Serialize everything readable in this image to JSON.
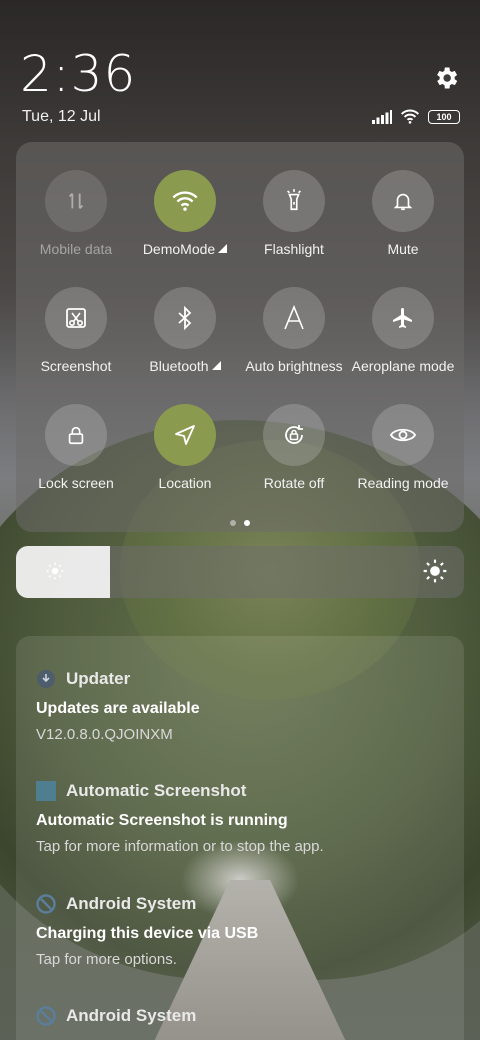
{
  "status": {
    "time": "2:36",
    "date": "Tue, 12 Jul",
    "battery": "100"
  },
  "tiles": [
    {
      "label": "Mobile data",
      "icon": "mobile-data-icon",
      "state": "disabled"
    },
    {
      "label": "DemoMode",
      "icon": "wifi-icon",
      "state": "active"
    },
    {
      "label": "Flashlight",
      "icon": "flashlight-icon",
      "state": "off"
    },
    {
      "label": "Mute",
      "icon": "bell-icon",
      "state": "off"
    },
    {
      "label": "Screenshot",
      "icon": "screenshot-icon",
      "state": "off"
    },
    {
      "label": "Bluetooth",
      "icon": "bluetooth-icon",
      "state": "off"
    },
    {
      "label": "Auto brightness",
      "icon": "auto-brightness-icon",
      "state": "off"
    },
    {
      "label": "Aeroplane mode",
      "icon": "airplane-icon",
      "state": "off"
    },
    {
      "label": "Lock screen",
      "icon": "lock-icon",
      "state": "off"
    },
    {
      "label": "Location",
      "icon": "location-icon",
      "state": "active"
    },
    {
      "label": "Rotate off",
      "icon": "rotate-lock-icon",
      "state": "off"
    },
    {
      "label": "Reading mode",
      "icon": "eye-icon",
      "state": "off"
    }
  ],
  "brightness": {
    "level": 0.21
  },
  "colors": {
    "active_tile": "#8a9a4f"
  },
  "notifications": [
    {
      "app": "Updater",
      "icon": "updater-icon",
      "title": "Updates are available",
      "text": "V12.0.8.0.QJOINXM"
    },
    {
      "app": "Automatic Screenshot",
      "icon": "app-square-icon",
      "title": "Automatic Screenshot is running",
      "text": "Tap for more information or to stop the app."
    },
    {
      "app": "Android System",
      "icon": "android-system-icon",
      "title": "Charging this device via USB",
      "text": "Tap for more options."
    },
    {
      "app": "Android System",
      "icon": "android-system-icon",
      "title": "",
      "text": ""
    }
  ]
}
